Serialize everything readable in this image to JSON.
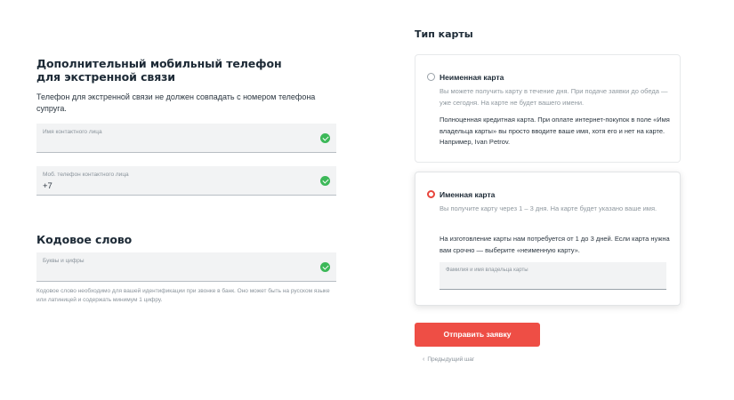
{
  "emergency": {
    "heading": "Дополнительный мобильный телефон для экстренной связи",
    "description": "Телефон для экстренной связи не должен совпадать с номером телефона супруга.",
    "contact_name": {
      "label": "Имя контактного лица",
      "value": ""
    },
    "contact_phone": {
      "label": "Моб. телефон контактного лица",
      "value": "+7"
    }
  },
  "codeword": {
    "heading": "Кодовое слово",
    "field": {
      "label": "Буквы и цифры",
      "value": ""
    },
    "hint": "Кодовое слово необходимо для вашей идентификации при звонке в банк. Оно может быть на русском языке или латиницей и содержать минимум 1 цифру."
  },
  "card_type": {
    "heading": "Тип карты",
    "options": [
      {
        "title": "Неименная карта",
        "selected": false,
        "note": "Вы можете получить карту в течение дня. При подаче заявки до обеда — уже сегодня. На карте не будет вашего имени.",
        "body": "Полноценная кредитная карта. При оплате интернет-покупок в поле «Имя владельца карты» вы просто вводите ваше имя, хотя его и нет на карте. Например, Ivan Petrov."
      },
      {
        "title": "Именная карта",
        "selected": true,
        "note": "Вы получите карту через 1 – 3 дня. На карте будет указано ваше имя.",
        "body": "На изготовление карты нам потребуется от 1 до 3 дней. Если карта нужна вам срочно — выберите «неименную карту».",
        "input_label": "Фамилия и имя владельца карты"
      }
    ]
  },
  "actions": {
    "submit": "Отправить заявку",
    "back": "Предыдущий шаг",
    "back_icon": "chevron-left-icon"
  },
  "colors": {
    "accent": "#ee4e45",
    "success": "#3cb858",
    "field_bg": "#f2f3f4"
  }
}
